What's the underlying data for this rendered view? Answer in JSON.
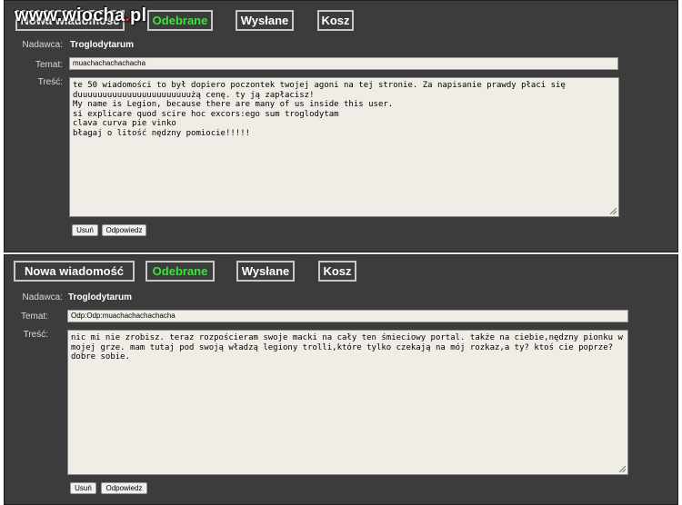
{
  "watermark": {
    "text_before_dot": "www.wiocha",
    "dot": ".",
    "text_after_dot": "pl"
  },
  "labels": {
    "sender": "Nadawca:",
    "subject": "Temat:",
    "body": "Treść:"
  },
  "tabs": {
    "new_message": "Nowa wiadomość",
    "inbox": "Odebrane",
    "sent": "Wysłane",
    "trash": "Kosz"
  },
  "buttons": {
    "delete": "Usuń",
    "reply": "Odpowiedz"
  },
  "messages": [
    {
      "sender": "Troglodytarum",
      "subject": "muachachachachacha",
      "body": "te 50 wiadomości to był dopiero poczontek twojej agoni na tej stronie. Za napisanie prawdy płaci się duuuuuuuuuuuuuuuuuuuuuuużą cenę. ty ją zapłacisz!\nMy name is Legion, because there are many of us inside this user.\nsi explicare quod scire hoc excors:ego sum troglodytam\nclava curva pie vinko\nbłagaj o litość nędzny pomiocie!!!!!"
    },
    {
      "sender": "Troglodytarum",
      "subject": "Odp:Odp:muachachachachacha",
      "body": "nic mi nie zrobisz. teraz rozpościeram swoje macki na cały ten śmieciowy portal. także na ciebie,nędzny pionku w mojej grze. mam tutaj pod swoją władzą legiony trolli,które tylko czekają na mój rozkaz,a ty? ktoś cie poprze? dobre sobie."
    }
  ],
  "colors": {
    "panel_bg": "#3c3c3c",
    "active_tab": "#3de33d",
    "field_bg": "#efede6"
  }
}
